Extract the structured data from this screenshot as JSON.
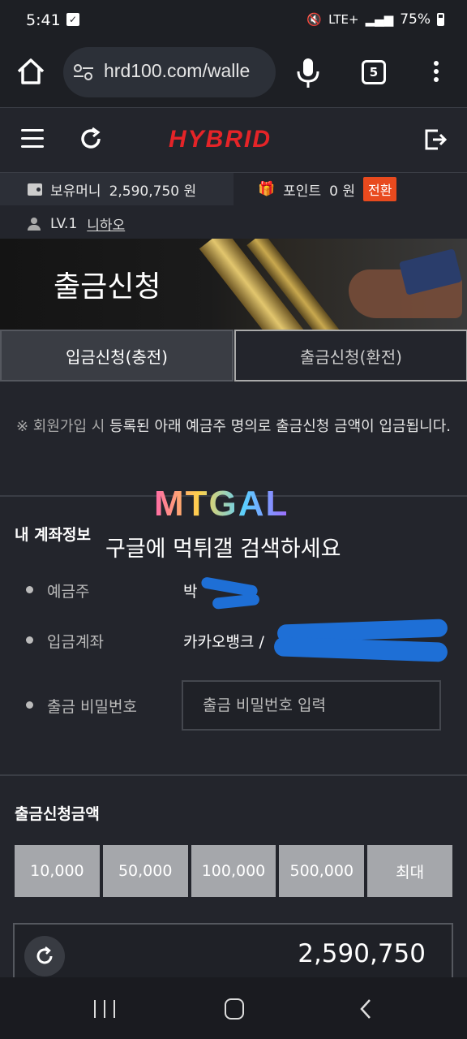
{
  "status_bar": {
    "time": "5:41",
    "network": "LTE+",
    "battery": "75%"
  },
  "browser": {
    "url": "hrd100.com/walle",
    "tab_count": "5"
  },
  "site": {
    "logo": "HYBRID",
    "brand_color": "#e52428"
  },
  "account": {
    "money_label": "보유머니",
    "money_value": "2,590,750 원",
    "point_label": "포인트",
    "point_value": "0 원",
    "convert_label": "전환",
    "level": "LV.1",
    "nickname": "니하오"
  },
  "banner": {
    "title": "출금신청"
  },
  "tabs": [
    {
      "label": "입금신청(충전)"
    },
    {
      "label": "출금신청(환전)"
    }
  ],
  "notice": {
    "prefix": "※ 회원가입 시",
    "text": " 등록된 아래 예금주 명의로 출금신청 금액이 입금됩니다."
  },
  "watermark": {
    "logo": "MTGAL",
    "text": "구글에 먹튀갤 검색하세요"
  },
  "account_info": {
    "title": "내 계좌정보",
    "holder_label": "예금주",
    "holder_value": "박",
    "bank_label": "입금계좌",
    "bank_value": "카카오뱅크 /",
    "password_label": "출금 비밀번호",
    "password_placeholder": "출금 비밀번호 입력"
  },
  "withdraw": {
    "title": "출금신청금액",
    "amount_buttons": [
      "10,000",
      "50,000",
      "100,000",
      "500,000",
      "최대"
    ],
    "amount_value": "2,590,750"
  }
}
